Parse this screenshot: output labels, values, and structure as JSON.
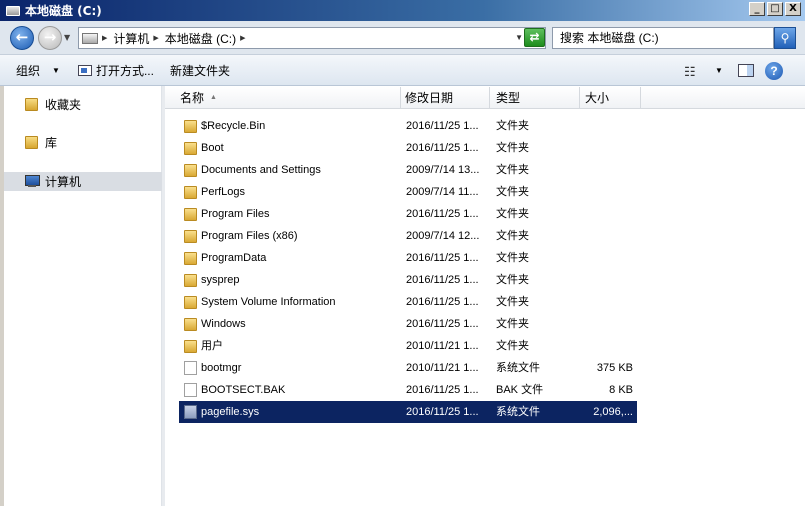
{
  "window": {
    "title": "本地磁盘 (C:)",
    "minimize": "_",
    "maximize": "□",
    "close": "X"
  },
  "address": {
    "crumbs": [
      "计算机",
      "本地磁盘 (C:)"
    ],
    "search_placeholder": "搜索 本地磁盘 (C:)"
  },
  "toolbar": {
    "organize": "组织",
    "open_with": "打开方式...",
    "new_folder": "新建文件夹"
  },
  "nav": {
    "items": [
      {
        "label": "收藏夹"
      },
      {
        "label": "库"
      },
      {
        "label": "计算机"
      }
    ]
  },
  "columns": {
    "name": "名称",
    "date": "修改日期",
    "type": "类型",
    "size": "大小"
  },
  "files": [
    {
      "name": "$Recycle.Bin",
      "date": "2016/11/25 1...",
      "type": "文件夹",
      "size": "",
      "icon": "folder"
    },
    {
      "name": "Boot",
      "date": "2016/11/25 1...",
      "type": "文件夹",
      "size": "",
      "icon": "folder"
    },
    {
      "name": "Documents and Settings",
      "date": "2009/7/14 13...",
      "type": "文件夹",
      "size": "",
      "icon": "folder"
    },
    {
      "name": "PerfLogs",
      "date": "2009/7/14 11...",
      "type": "文件夹",
      "size": "",
      "icon": "folder"
    },
    {
      "name": "Program Files",
      "date": "2016/11/25 1...",
      "type": "文件夹",
      "size": "",
      "icon": "folder"
    },
    {
      "name": "Program Files (x86)",
      "date": "2009/7/14 12...",
      "type": "文件夹",
      "size": "",
      "icon": "folder"
    },
    {
      "name": "ProgramData",
      "date": "2016/11/25 1...",
      "type": "文件夹",
      "size": "",
      "icon": "folder"
    },
    {
      "name": "sysprep",
      "date": "2016/11/25 1...",
      "type": "文件夹",
      "size": "",
      "icon": "folder"
    },
    {
      "name": "System Volume Information",
      "date": "2016/11/25 1...",
      "type": "文件夹",
      "size": "",
      "icon": "folder"
    },
    {
      "name": "Windows",
      "date": "2016/11/25 1...",
      "type": "文件夹",
      "size": "",
      "icon": "folder"
    },
    {
      "name": "用户",
      "date": "2010/11/21 1...",
      "type": "文件夹",
      "size": "",
      "icon": "folder"
    },
    {
      "name": "bootmgr",
      "date": "2010/11/21 1...",
      "type": "系统文件",
      "size": "375 KB",
      "icon": "file"
    },
    {
      "name": "BOOTSECT.BAK",
      "date": "2016/11/25 1...",
      "type": "BAK 文件",
      "size": "8 KB",
      "icon": "file"
    },
    {
      "name": "pagefile.sys",
      "date": "2016/11/25 1...",
      "type": "系统文件",
      "size": "2,096,...",
      "icon": "sysfile",
      "selected": true
    }
  ]
}
